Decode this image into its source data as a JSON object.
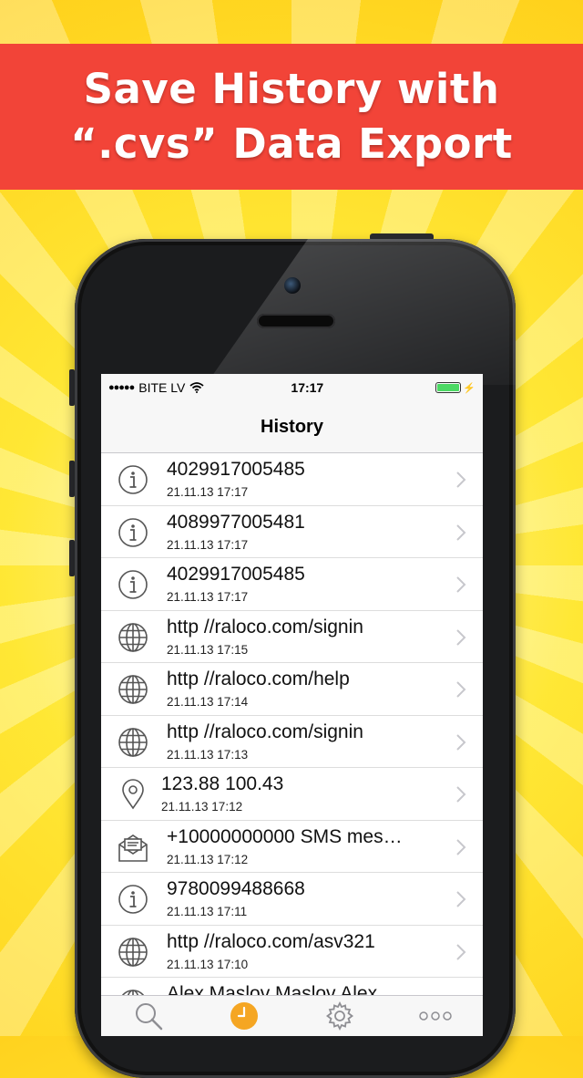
{
  "banner": {
    "line1": "Save History with",
    "line2": "“.cvs” Data Export"
  },
  "status_bar": {
    "signal_dots": "●●●●●",
    "carrier": "BITE LV",
    "time": "17:17",
    "wifi_icon": "wifi-icon",
    "battery_icon": "battery-charging-icon"
  },
  "nav": {
    "title": "History"
  },
  "history": [
    {
      "icon": "info-icon",
      "title": "4029917005485",
      "date": "21.11.13 17:17"
    },
    {
      "icon": "info-icon",
      "title": "4089977005481",
      "date": "21.11.13 17:17"
    },
    {
      "icon": "info-icon",
      "title": "4029917005485",
      "date": "21.11.13 17:17"
    },
    {
      "icon": "globe-icon",
      "title": "http //raloco.com/signin",
      "date": "21.11.13 17:15"
    },
    {
      "icon": "globe-icon",
      "title": "http //raloco.com/help",
      "date": "21.11.13 17:14"
    },
    {
      "icon": "globe-icon",
      "title": "http //raloco.com/signin",
      "date": "21.11.13 17:13"
    },
    {
      "icon": "location-pin-icon",
      "title": "123.88 100.43",
      "date": "21.11.13 17:12"
    },
    {
      "icon": "envelope-icon",
      "title": "+10000000000 SMS mes…",
      "date": "21.11.13 17:12"
    },
    {
      "icon": "info-icon",
      "title": "9780099488668",
      "date": "21.11.13 17:11"
    },
    {
      "icon": "globe-icon",
      "title": "http //raloco.com/asv321",
      "date": "21.11.13 17:10"
    },
    {
      "icon": "globe-icon",
      "title": "Alex Maslov Maslov Alex",
      "date": ""
    }
  ],
  "tabbar": {
    "tabs": [
      {
        "icon": "search-icon"
      },
      {
        "icon": "history-clock-icon",
        "active": true
      },
      {
        "icon": "gear-icon"
      },
      {
        "icon": "more-dots-icon"
      }
    ],
    "active_color": "#f5a623",
    "inactive_color": "#8e8e93"
  },
  "colors": {
    "banner_bg": "#f24438",
    "background": "#ffd21e"
  }
}
